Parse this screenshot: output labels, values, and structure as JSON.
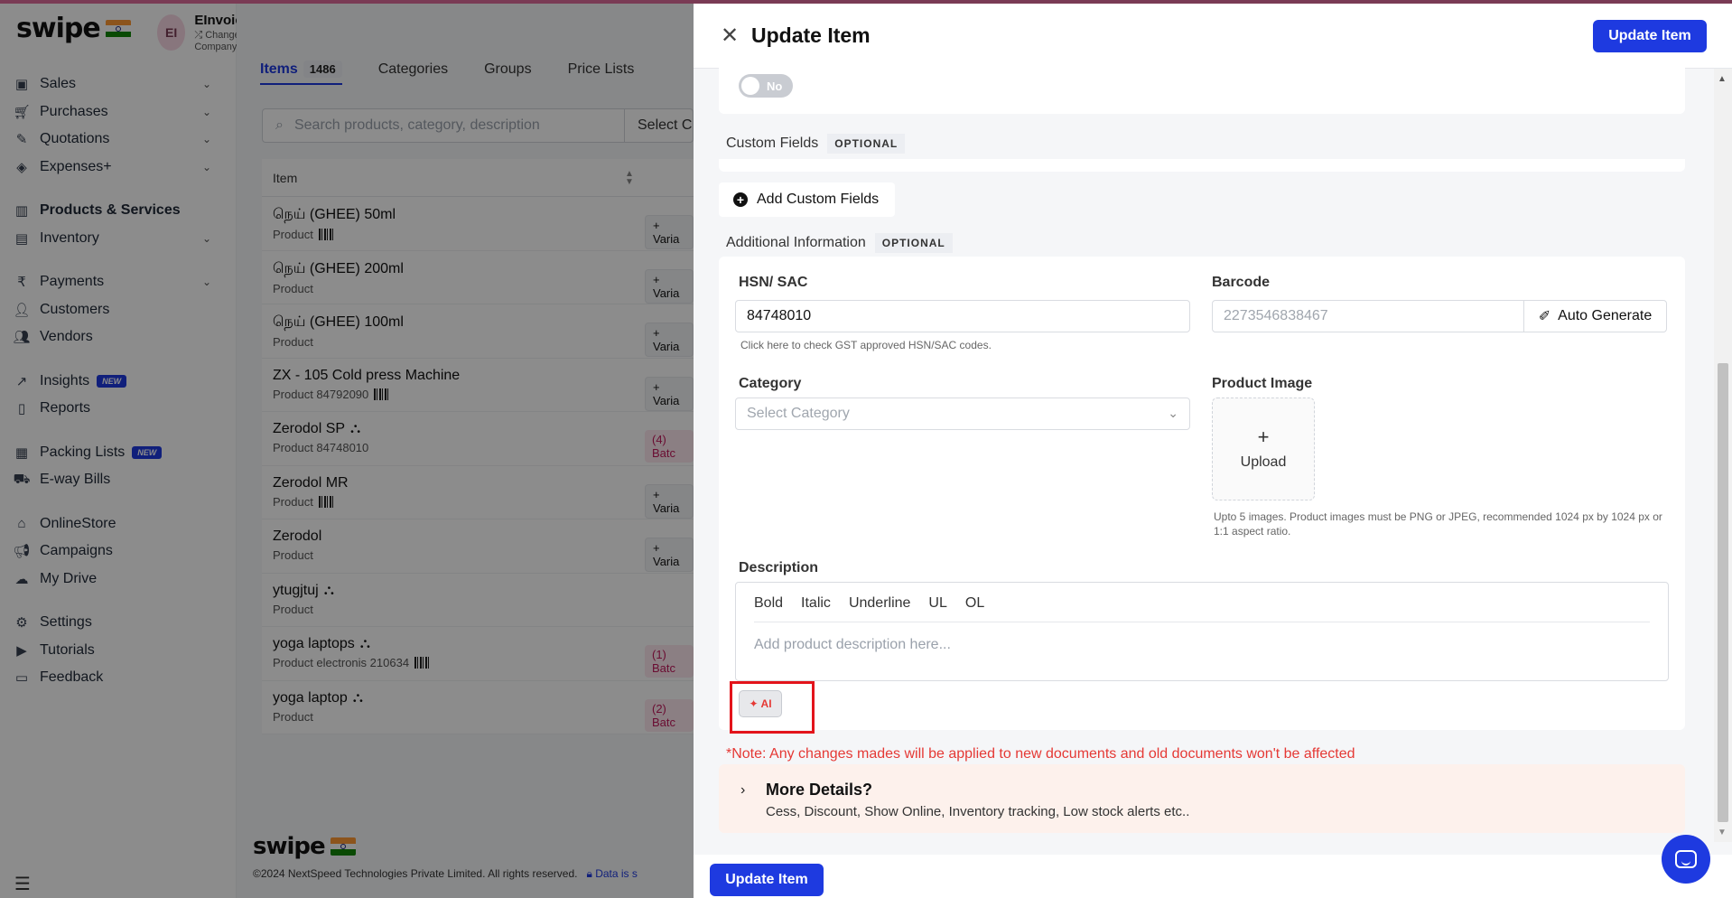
{
  "app": {
    "brand": "swipe",
    "company_initials": "EI",
    "company_name": "EInvoices",
    "change_company": "Change Company",
    "colors": {
      "primary": "#1e3ae0",
      "danger": "#e53935",
      "accent_bar": "#7a3b55"
    }
  },
  "sidebar": {
    "items": [
      {
        "label": "Sales",
        "icon": "money-icon"
      },
      {
        "label": "Purchases",
        "icon": "cart-icon"
      },
      {
        "label": "Quotations",
        "icon": "pen-icon"
      },
      {
        "label": "Expenses+",
        "icon": "tag-icon"
      },
      {
        "label": "Products & Services",
        "icon": "barcode-icon"
      },
      {
        "label": "Inventory",
        "icon": "chart-icon"
      },
      {
        "label": "Payments",
        "icon": "rupee-icon"
      },
      {
        "label": "Customers",
        "icon": "user-icon"
      },
      {
        "label": "Vendors",
        "icon": "users-icon"
      },
      {
        "label": "Insights",
        "icon": "trend-icon",
        "badge": "NEW"
      },
      {
        "label": "Reports",
        "icon": "file-icon"
      },
      {
        "label": "Packing Lists",
        "icon": "box-icon",
        "badge": "NEW"
      },
      {
        "label": "E-way Bills",
        "icon": "truck-icon"
      },
      {
        "label": "OnlineStore",
        "icon": "store-icon"
      },
      {
        "label": "Campaigns",
        "icon": "megaphone-icon"
      },
      {
        "label": "My Drive",
        "icon": "cloud-icon"
      },
      {
        "label": "Settings",
        "icon": "gear-icon"
      },
      {
        "label": "Tutorials",
        "icon": "play-icon"
      },
      {
        "label": "Feedback",
        "icon": "chat-icon"
      }
    ]
  },
  "items_page": {
    "tabs": [
      {
        "label": "Items",
        "count": "1486"
      },
      {
        "label": "Categories"
      },
      {
        "label": "Groups"
      },
      {
        "label": "Price Lists"
      }
    ],
    "search_placeholder": "Search products, category, description",
    "select_label": "Select C",
    "column_item": "Item",
    "variant_label": "+ Varia",
    "rows": [
      {
        "name": "நெய் (GHEE) 50ml",
        "sub": "Product",
        "action": "+ Varia"
      },
      {
        "name": "நெய் (GHEE) 200ml",
        "sub": "Product",
        "action": "+ Varia"
      },
      {
        "name": "நெய் (GHEE) 100ml",
        "sub": "Product",
        "action": "+ Varia"
      },
      {
        "name": "ZX - 105 Cold press Machine",
        "sub": "Product  84792090",
        "action": "+ Varia"
      },
      {
        "name": "Zerodol SP",
        "sub": "Product  84748010",
        "batch": "(4) Batc"
      },
      {
        "name": "Zerodol MR",
        "sub": "Product",
        "action": "+ Varia"
      },
      {
        "name": "Zerodol",
        "sub": "Product",
        "action": "+ Varia"
      },
      {
        "name": "ytugjtuj",
        "sub": "Product"
      },
      {
        "name": "yoga laptops",
        "sub": "Product electronis 210634",
        "batch": "(1) Batc"
      },
      {
        "name": "yoga laptop",
        "sub": "Product",
        "batch": "(2) Batc"
      }
    ],
    "footer_copy": "©2024 NextSpeed Technologies Private Limited. All rights reserved.",
    "footer_link": "Data is s"
  },
  "drawer": {
    "title": "Update Item",
    "update_button": "Update Item",
    "toggle_label": "No",
    "custom_fields_label": "Custom Fields",
    "optional_tag": "OPTIONAL",
    "add_custom_fields": "Add Custom Fields",
    "additional_info_label": "Additional Information",
    "hsn_label": "HSN/ SAC",
    "hsn_value": "84748010",
    "hsn_hint": "Click here to check GST approved HSN/SAC codes.",
    "barcode_label": "Barcode",
    "barcode_placeholder": "2273546838467",
    "auto_generate": "Auto Generate",
    "category_label": "Category",
    "category_placeholder": "Select Category",
    "image_label": "Product Image",
    "upload_label": "Upload",
    "image_hint": "Upto 5 images. Product images must be PNG or JPEG, recommended 1024 px by 1024 px or 1:1 aspect ratio.",
    "description_label": "Description",
    "toolbar": [
      "Bold",
      "Italic",
      "Underline",
      "UL",
      "OL"
    ],
    "description_placeholder": "Add product description here...",
    "ai_button": "AI",
    "note": "*Note: Any changes mades will be applied to new documents and old documents won't be affected",
    "more_title": "More Details?",
    "more_sub": "Cess, Discount, Show Online, Inventory tracking, Low stock alerts etc.."
  }
}
